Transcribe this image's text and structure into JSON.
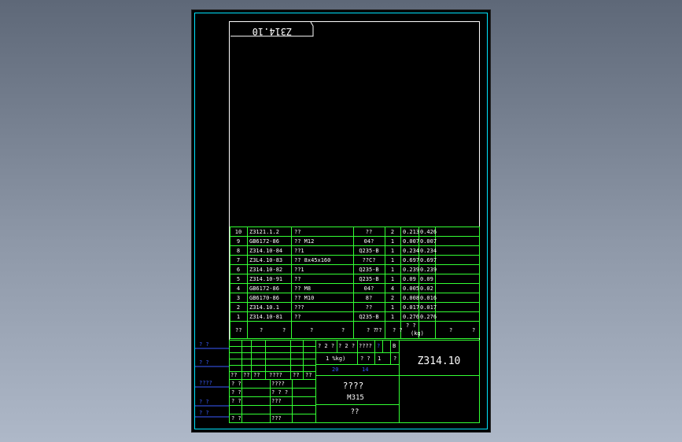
{
  "drawing": {
    "flipped_label": "Z314.10",
    "title_code": "Z314.10",
    "title_name_line1": "????",
    "title_name_line2": "M315",
    "title_bottom": "??"
  },
  "bom": {
    "rows": [
      {
        "no": "10",
        "code": "Z3121.1.2",
        "name": "??",
        "material": "??",
        "qty": "2",
        "unit": "0.213",
        "total": "0.426"
      },
      {
        "no": "9",
        "code": "GB6172-86",
        "name": "?? M12",
        "material": "04?",
        "qty": "1",
        "unit": "0.007",
        "total": "0.007"
      },
      {
        "no": "8",
        "code": "Z314.10-84",
        "name": "??1",
        "material": "Q235-B",
        "qty": "1",
        "unit": "0.234",
        "total": "0.234"
      },
      {
        "no": "7",
        "code": "Z3L4.10-83",
        "name": "?? 8x45x160",
        "material": "??C?",
        "qty": "1",
        "unit": "0.697",
        "total": "0.697"
      },
      {
        "no": "6",
        "code": "Z314.10-82",
        "name": "??1",
        "material": "Q235-B",
        "qty": "1",
        "unit": "0.239",
        "total": "0.239"
      },
      {
        "no": "5",
        "code": "Z314.10-91",
        "name": "??",
        "material": "Q235-B",
        "qty": "1",
        "unit": "0.09",
        "total": "0.09"
      },
      {
        "no": "4",
        "code": "GB6172-86",
        "name": "?? M8",
        "material": "04?",
        "qty": "4",
        "unit": "0.005",
        "total": "0.02"
      },
      {
        "no": "3",
        "code": "GB6170-86",
        "name": "?? M10",
        "material": "8?",
        "qty": "2",
        "unit": "0.008",
        "total": "0.016"
      },
      {
        "no": "2",
        "code": "Z314.10.1",
        "name": "???",
        "material": "??",
        "qty": "1",
        "unit": "0.017",
        "total": "0.017"
      },
      {
        "no": "1",
        "code": "Z314.10-81",
        "name": "??",
        "material": "Q235-B",
        "qty": "1",
        "unit": "0.276",
        "total": "0.276"
      }
    ],
    "header": [
      "??",
      "?",
      "?",
      "?",
      "?",
      "? ?",
      "??",
      "? ?",
      "? ?",
      "(kg)",
      "?",
      "?"
    ]
  },
  "title_block": {
    "cells": [
      "? 2 ?",
      "? 2 ?",
      "????",
      "?",
      "B",
      "1 %kg)",
      "? ?",
      "1",
      "?",
      "20",
      "14"
    ],
    "sign_rows": [
      "??",
      "??",
      "??",
      "????",
      "??",
      "??"
    ],
    "person_rows": [
      [
        "? ?",
        "????"
      ],
      [
        "? ?",
        "? ? ?"
      ],
      [
        "? ?",
        "???"
      ],
      [
        "? ?",
        "???"
      ]
    ]
  },
  "left_strip": [
    "? ?",
    "? ?",
    "????",
    "? ?",
    "? ?"
  ]
}
